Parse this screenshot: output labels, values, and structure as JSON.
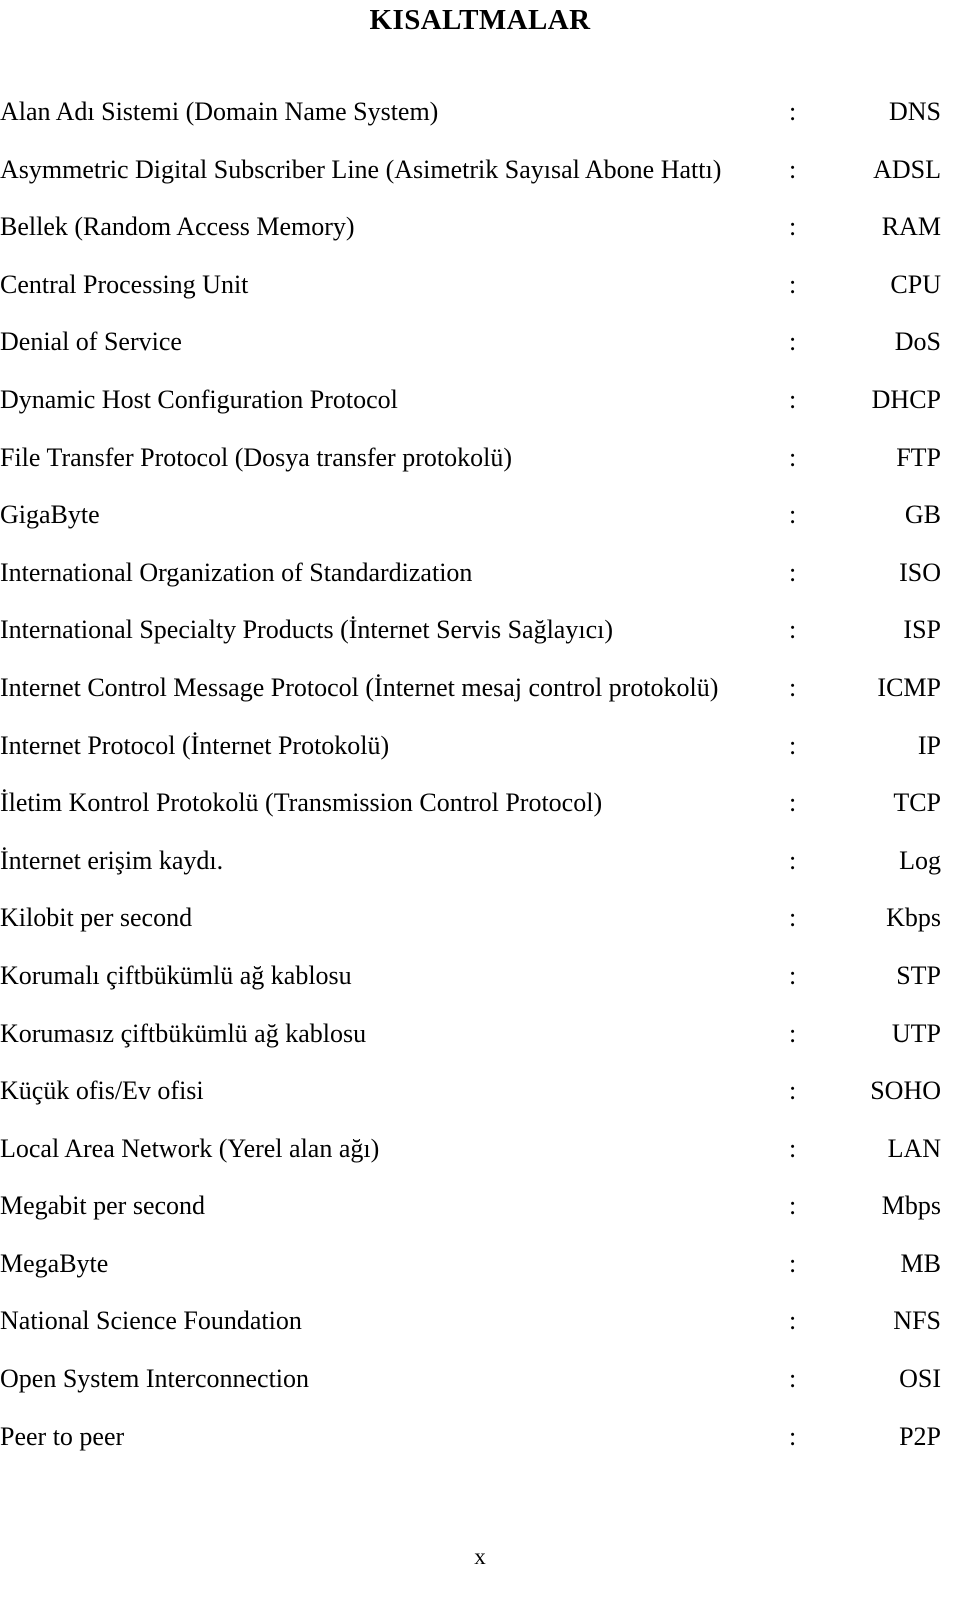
{
  "document": {
    "title": "KISALTMALAR",
    "page_number": "x",
    "separator": ":"
  },
  "abbreviations": [
    {
      "term": "Alan Adı Sistemi (Domain Name System)",
      "abbr": "DNS"
    },
    {
      "term": "Asymmetric Digital Subscriber Line (Asimetrik Sayısal Abone Hattı)",
      "abbr": "ADSL"
    },
    {
      "term": "Bellek (Random Access Memory)",
      "abbr": "RAM"
    },
    {
      "term": "Central Processing Unit",
      "abbr": "CPU"
    },
    {
      "term": "Denial of Service",
      "abbr": "DoS"
    },
    {
      "term": "Dynamic Host Configuration Protocol",
      "abbr": "DHCP"
    },
    {
      "term": "File Transfer Protocol (Dosya transfer protokolü)",
      "abbr": "FTP"
    },
    {
      "term": "GigaByte",
      "abbr": "GB"
    },
    {
      "term": "International Organization of Standardization",
      "abbr": "ISO"
    },
    {
      "term": "International Specialty Products (İnternet Servis Sağlayıcı)",
      "abbr": "ISP"
    },
    {
      "term": "Internet Control Message Protocol (İnternet mesaj control protokolü)",
      "abbr": "ICMP"
    },
    {
      "term": "Internet Protocol (İnternet Protokolü)",
      "abbr": "IP"
    },
    {
      "term": "İletim Kontrol Protokolü (Transmission Control Protocol)",
      "abbr": "TCP"
    },
    {
      "term": "İnternet erişim kaydı.",
      "abbr": "Log"
    },
    {
      "term": "Kilobit per second",
      "abbr": "Kbps"
    },
    {
      "term": "Korumalı çiftbükümlü ağ kablosu",
      "abbr": "STP"
    },
    {
      "term": "Korumasız çiftbükümlü ağ kablosu",
      "abbr": "UTP"
    },
    {
      "term": "Küçük ofis/Ev ofisi",
      "abbr": "SOHO"
    },
    {
      "term": "Local Area Network (Yerel alan ağı)",
      "abbr": "LAN"
    },
    {
      "term": "Megabit per second",
      "abbr": "Mbps"
    },
    {
      "term": "MegaByte",
      "abbr": "MB"
    },
    {
      "term": "National Science Foundation",
      "abbr": "NFS"
    },
    {
      "term": "Open System Interconnection",
      "abbr": "OSI"
    },
    {
      "term": "Peer to peer",
      "abbr": "P2P"
    }
  ]
}
